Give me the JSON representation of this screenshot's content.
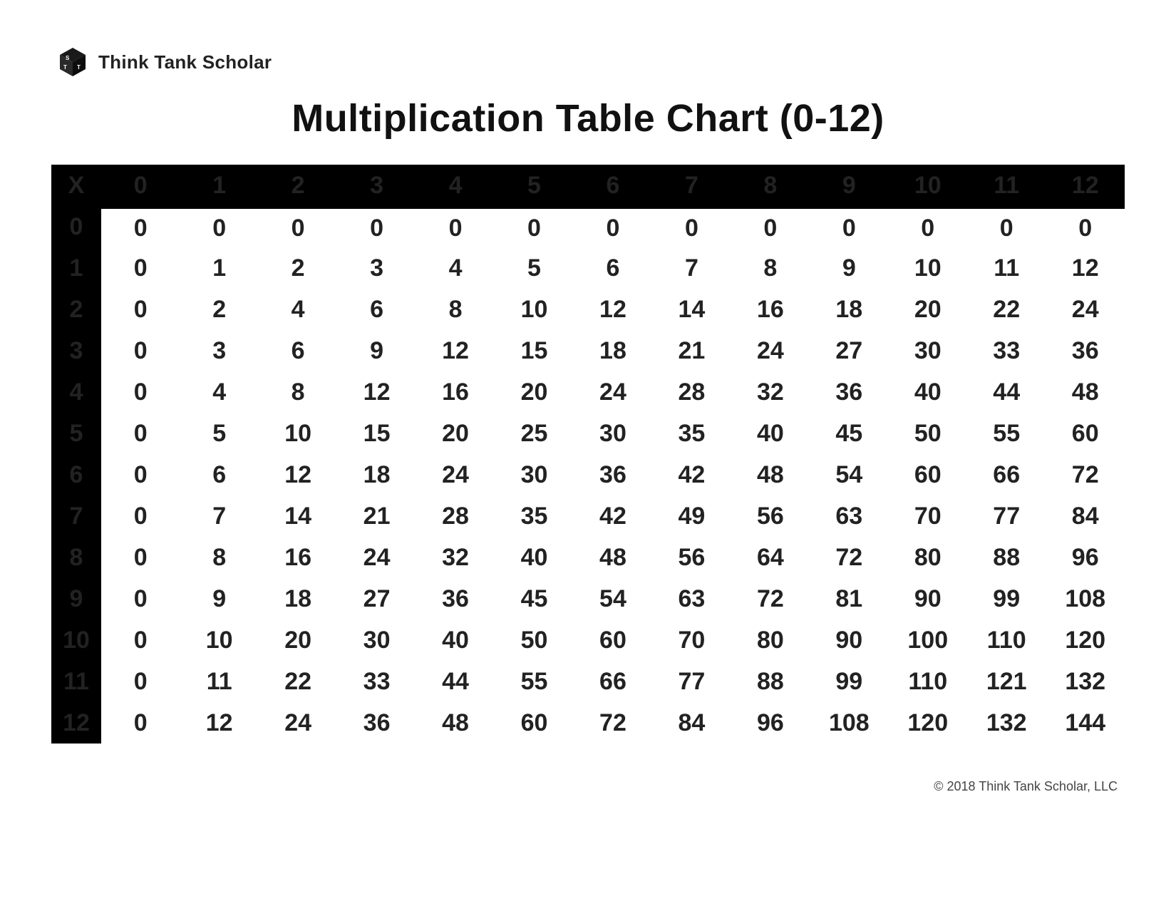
{
  "brand": "Think Tank Scholar",
  "title": "Multiplication Table Chart (0-12)",
  "corner_label": "X",
  "col_headers": [
    "0",
    "1",
    "2",
    "3",
    "4",
    "5",
    "6",
    "7",
    "8",
    "9",
    "10",
    "11",
    "12"
  ],
  "row_headers": [
    "0",
    "1",
    "2",
    "3",
    "4",
    "5",
    "6",
    "7",
    "8",
    "9",
    "10",
    "11",
    "12"
  ],
  "chart_data": {
    "type": "table",
    "title": "Multiplication Table Chart (0-12)",
    "row_labels": [
      "0",
      "1",
      "2",
      "3",
      "4",
      "5",
      "6",
      "7",
      "8",
      "9",
      "10",
      "11",
      "12"
    ],
    "col_labels": [
      "0",
      "1",
      "2",
      "3",
      "4",
      "5",
      "6",
      "7",
      "8",
      "9",
      "10",
      "11",
      "12"
    ],
    "values": [
      [
        0,
        0,
        0,
        0,
        0,
        0,
        0,
        0,
        0,
        0,
        0,
        0,
        0
      ],
      [
        0,
        1,
        2,
        3,
        4,
        5,
        6,
        7,
        8,
        9,
        10,
        11,
        12
      ],
      [
        0,
        2,
        4,
        6,
        8,
        10,
        12,
        14,
        16,
        18,
        20,
        22,
        24
      ],
      [
        0,
        3,
        6,
        9,
        12,
        15,
        18,
        21,
        24,
        27,
        30,
        33,
        36
      ],
      [
        0,
        4,
        8,
        12,
        16,
        20,
        24,
        28,
        32,
        36,
        40,
        44,
        48
      ],
      [
        0,
        5,
        10,
        15,
        20,
        25,
        30,
        35,
        40,
        45,
        50,
        55,
        60
      ],
      [
        0,
        6,
        12,
        18,
        24,
        30,
        36,
        42,
        48,
        54,
        60,
        66,
        72
      ],
      [
        0,
        7,
        14,
        21,
        28,
        35,
        42,
        49,
        56,
        63,
        70,
        77,
        84
      ],
      [
        0,
        8,
        16,
        24,
        32,
        40,
        48,
        56,
        64,
        72,
        80,
        88,
        96
      ],
      [
        0,
        9,
        18,
        27,
        36,
        45,
        54,
        63,
        72,
        81,
        90,
        99,
        108
      ],
      [
        0,
        10,
        20,
        30,
        40,
        50,
        60,
        70,
        80,
        90,
        100,
        110,
        120
      ],
      [
        0,
        11,
        22,
        33,
        44,
        55,
        66,
        77,
        88,
        99,
        110,
        121,
        132
      ],
      [
        0,
        12,
        24,
        36,
        48,
        60,
        72,
        84,
        96,
        108,
        120,
        132,
        144
      ]
    ]
  },
  "copyright": "© 2018 Think Tank Scholar, LLC"
}
